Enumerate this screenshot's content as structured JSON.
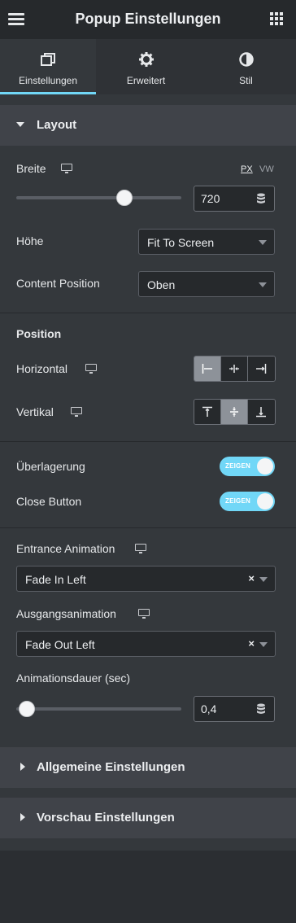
{
  "header": {
    "title": "Popup Einstellungen",
    "menu_icon": "hamburger-menu-icon",
    "apps_icon": "grid-apps-icon"
  },
  "tabs": [
    {
      "label": "Einstellungen",
      "icon": "window-icon",
      "active": true
    },
    {
      "label": "Erweitert",
      "icon": "gear-icon",
      "active": false
    },
    {
      "label": "Stil",
      "icon": "contrast-icon",
      "active": false
    }
  ],
  "layout": {
    "title": "Layout",
    "breite": {
      "label": "Breite",
      "units": [
        "PX",
        "VW"
      ],
      "active_unit": "PX",
      "value": "720",
      "slider_fraction": 0.67
    },
    "hoehe": {
      "label": "Höhe",
      "value": "Fit To Screen"
    },
    "content_position": {
      "label": "Content Position",
      "value": "Oben"
    },
    "position": {
      "title": "Position",
      "horizontal": {
        "label": "Horizontal",
        "options": [
          "align-left-icon",
          "align-center-horizontal-icon",
          "align-right-icon"
        ],
        "selected_index": 0
      },
      "vertikal": {
        "label": "Vertikal",
        "options": [
          "align-top-icon",
          "align-middle-icon",
          "align-bottom-icon"
        ],
        "selected_index": 1
      }
    },
    "overlay": {
      "label": "Überlagerung",
      "toggle_text": "ZEIGEN",
      "enabled": true
    },
    "close_button": {
      "label": "Close Button",
      "toggle_text": "ZEIGEN",
      "enabled": true
    },
    "entrance_animation": {
      "label": "Entrance Animation",
      "value": "Fade In Left",
      "clear": "×"
    },
    "exit_animation": {
      "label": "Ausgangsanimation",
      "value": "Fade Out Left",
      "clear": "×"
    },
    "duration": {
      "label": "Animationsdauer (sec)",
      "value": "0,4",
      "slider_fraction": 0.0
    }
  },
  "sections": [
    {
      "title": "Allgemeine Einstellungen",
      "expanded": false
    },
    {
      "title": "Vorschau Einstellungen",
      "expanded": false
    }
  ],
  "colors": {
    "accent": "#71d7f7",
    "panel": "#34383c",
    "header": "#26292c"
  }
}
